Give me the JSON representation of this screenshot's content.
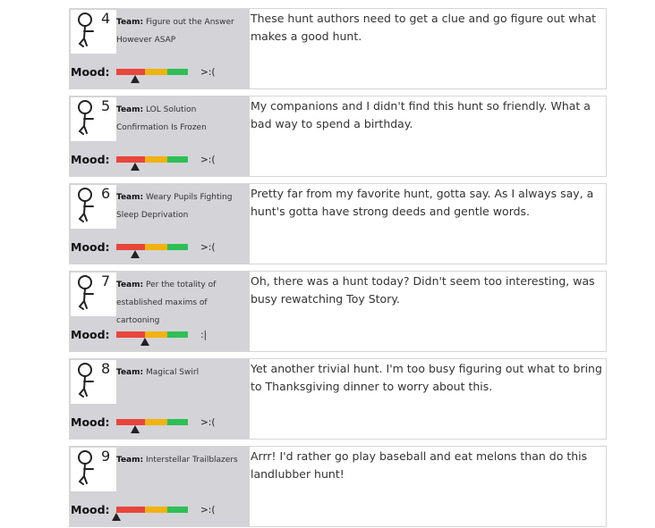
{
  "team_prefix": "Team:",
  "mood_label": "Mood:",
  "colors": {
    "bad": "#e8453c",
    "neutral": "#f0b310",
    "good": "#2ebf57",
    "panel": "#d3d3d8"
  },
  "entries": [
    {
      "number": "4",
      "team": "Figure out the Answer However ASAP",
      "comment": "These hunt authors need to get a clue and go figure out what makes a good hunt.",
      "mood_level": 0.26,
      "mood_face": ">:("
    },
    {
      "number": "5",
      "team": "LOL Solution Confirmation Is Frozen",
      "comment": "My companions and I didn't find this hunt so friendly. What a bad way to spend a birthday.",
      "mood_level": 0.26,
      "mood_face": ">:("
    },
    {
      "number": "6",
      "team": "Weary Pupils Fighting Sleep Deprivation",
      "comment": "Pretty far from my favorite hunt, gotta say. As I always say, a hunt's gotta have strong deeds and gentle words.",
      "mood_level": 0.26,
      "mood_face": ">:("
    },
    {
      "number": "7",
      "team": "Per the totality of established maxims of cartooning",
      "comment": "Oh, there was a hunt today? Didn't seem too interesting, was busy rewatching Toy Story.",
      "mood_level": 0.4,
      "mood_face": ":|"
    },
    {
      "number": "8",
      "team": "Magical Swirl",
      "comment": "Yet another trivial hunt. I'm too busy figuring out what to bring to Thanksgiving dinner to worry about this.",
      "mood_level": 0.26,
      "mood_face": ">:("
    },
    {
      "number": "9",
      "team": "Interstellar Trailblazers",
      "comment": "Arrr! I'd rather go play baseball and eat melons than do this landlubber hunt!",
      "mood_level": 0.0,
      "mood_face": ">:("
    }
  ]
}
